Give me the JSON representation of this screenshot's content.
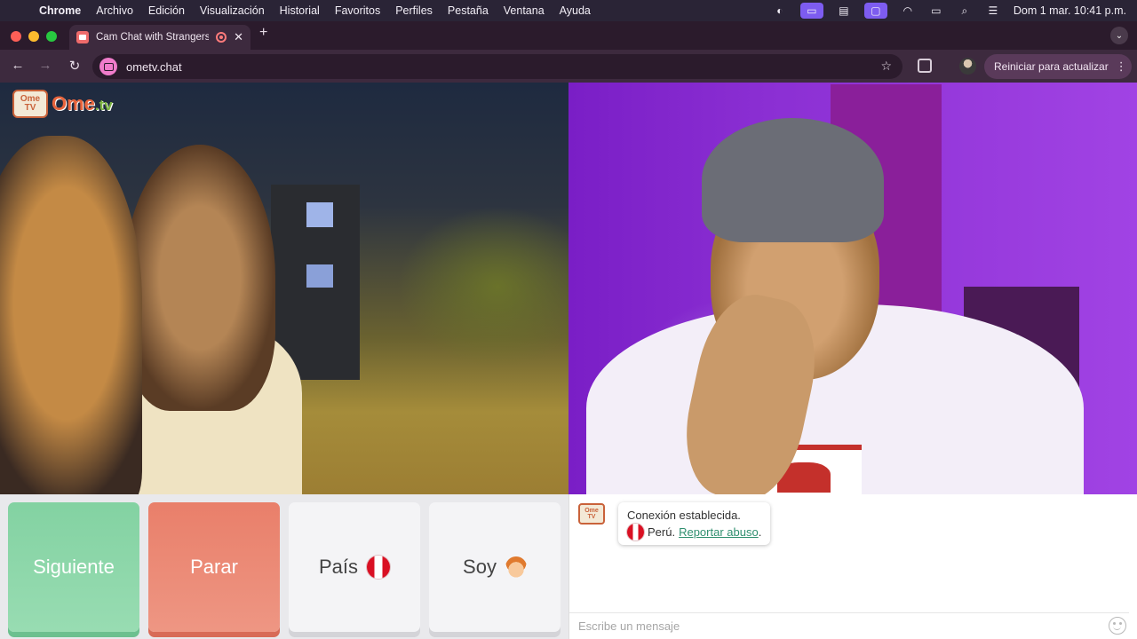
{
  "menubar": {
    "app": "Chrome",
    "items": [
      "Archivo",
      "Edición",
      "Visualización",
      "Historial",
      "Favoritos",
      "Perfiles",
      "Pestaña",
      "Ventana",
      "Ayuda"
    ],
    "clock": "Dom 1 mar.  10:41 p.m."
  },
  "tab": {
    "title": "Cam Chat with Strangers",
    "close": "✕",
    "new": "+"
  },
  "toolbar": {
    "url": "ometv.chat",
    "update_label": "Reiniciar para actualizar"
  },
  "logo": {
    "tv_top": "Ome",
    "tv_bottom": "TV",
    "word": "Ome",
    "word_suffix": ".tv"
  },
  "controls": {
    "next_label": "Siguiente",
    "stop_label": "Parar",
    "country_label": "País",
    "gender_label": "Soy"
  },
  "chat": {
    "status": "Conexión establecida.",
    "country": "Perú.",
    "report_label": "Reportar abuso",
    "period": ".",
    "placeholder": "Escribe un mensaje"
  },
  "colors": {
    "next": "#8fd6a9",
    "stop": "#ec8a74",
    "link": "#2f8f6f",
    "peru_red": "#d91023"
  },
  "icons": {
    "country_flag": "peru-flag-icon",
    "gender": "boy-icon"
  }
}
